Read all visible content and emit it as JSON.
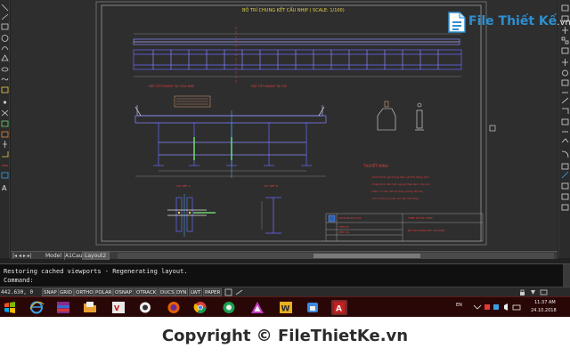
{
  "drawing": {
    "title": "BỐ TRÍ CHUNG KẾT CẤU NHỊP ( SCALE: 1/100)",
    "section_label_left": "MẶT CẮT NGANG TẠI GIỮA NHỊP",
    "section_label_mid": "MẶT CẮT NGANG TẠI GỐI",
    "detail_label_left": "CHI TIẾT A",
    "detail_label_mid": "CHI TIẾT B",
    "notes_heading": "THUYẾT MINH",
    "notes": [
      "- Kích thước ghi trong bản vẽ tính bằng mm",
      "- Thép hình liên kết ngang thép tấm chịu lực",
      "- Dầm có liên kết bu lông cường độ cao",
      "- Sơn chống gỉ toàn bộ kết cấu thép"
    ],
    "title_block": {
      "org": "TRƯỜNG ĐẠI HỌC",
      "project": "THIẾT KẾ CẦU THÉP",
      "sheet": "BỐ TRÍ CHUNG KẾT CẤU NHỊP",
      "row1": "THIẾT KẾ",
      "row2": "KIỂM TRA"
    }
  },
  "watermark": {
    "brand": "File Thiết Kế",
    "suffix": ".vn"
  },
  "layout_tabs": [
    "Model",
    "A1Cau",
    "Layout2"
  ],
  "active_tab": "Layout2",
  "tab_nav": "|◂ ◂ ▸ ▸|",
  "command": {
    "history": "Restoring cached viewports - Regenerating layout.",
    "prompt": "Command:"
  },
  "status": {
    "coordinates": "442.630, 0",
    "toggles": [
      "SNAP",
      "GRID",
      "ORTHO",
      "POLAR",
      "OSNAP",
      "OTRACK",
      "DUCS",
      "DYN",
      "LWT",
      "PAPER"
    ]
  },
  "taskbar": {
    "apps": [
      "windows-start",
      "internet-explorer",
      "winrar",
      "file-explorer",
      "unikey",
      "media-player",
      "firefox",
      "chrome",
      "coc-coc",
      "screen-tool",
      "word",
      "vpn",
      "autocad"
    ],
    "language": "EN",
    "time": "11:37 AM",
    "date": "24.10.2018"
  },
  "footer": {
    "copyright": "Copyright © FileThietKe.vn"
  },
  "colors": {
    "accent": "#2d8fd1",
    "canvas": "#2e2e2e",
    "taskbar": "#2a0707",
    "cad_blue": "#6a6aff",
    "cad_yellow": "#e6d04a",
    "cad_red": "#e04040"
  }
}
